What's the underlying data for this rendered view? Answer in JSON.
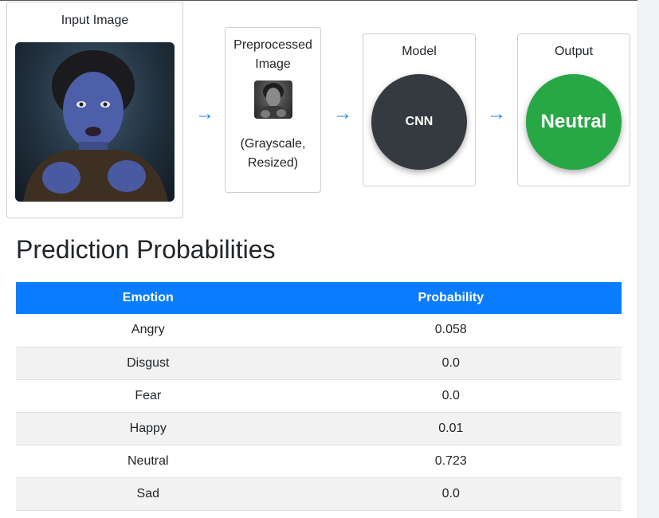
{
  "pipeline": {
    "input": {
      "title": "Input Image"
    },
    "preprocessed": {
      "title_line1": "Preprocessed",
      "title_line2": "Image",
      "caption_line1": "(Grayscale,",
      "caption_line2": "Resized)"
    },
    "model": {
      "title": "Model",
      "label": "CNN"
    },
    "output": {
      "title": "Output",
      "label": "Neutral"
    },
    "arrow": "→"
  },
  "predictions": {
    "heading": "Prediction Probabilities",
    "columns": [
      "Emotion",
      "Probability"
    ],
    "rows": [
      {
        "emotion": "Angry",
        "probability": "0.058"
      },
      {
        "emotion": "Disgust",
        "probability": "0.0"
      },
      {
        "emotion": "Fear",
        "probability": "0.0"
      },
      {
        "emotion": "Happy",
        "probability": "0.01"
      },
      {
        "emotion": "Neutral",
        "probability": "0.723"
      },
      {
        "emotion": "Sad",
        "probability": "0.0"
      }
    ]
  },
  "colors": {
    "header_blue": "#0a7cff",
    "arrow_blue": "#1a7ff0",
    "model_circle": "#343a40",
    "output_circle": "#28a745"
  }
}
